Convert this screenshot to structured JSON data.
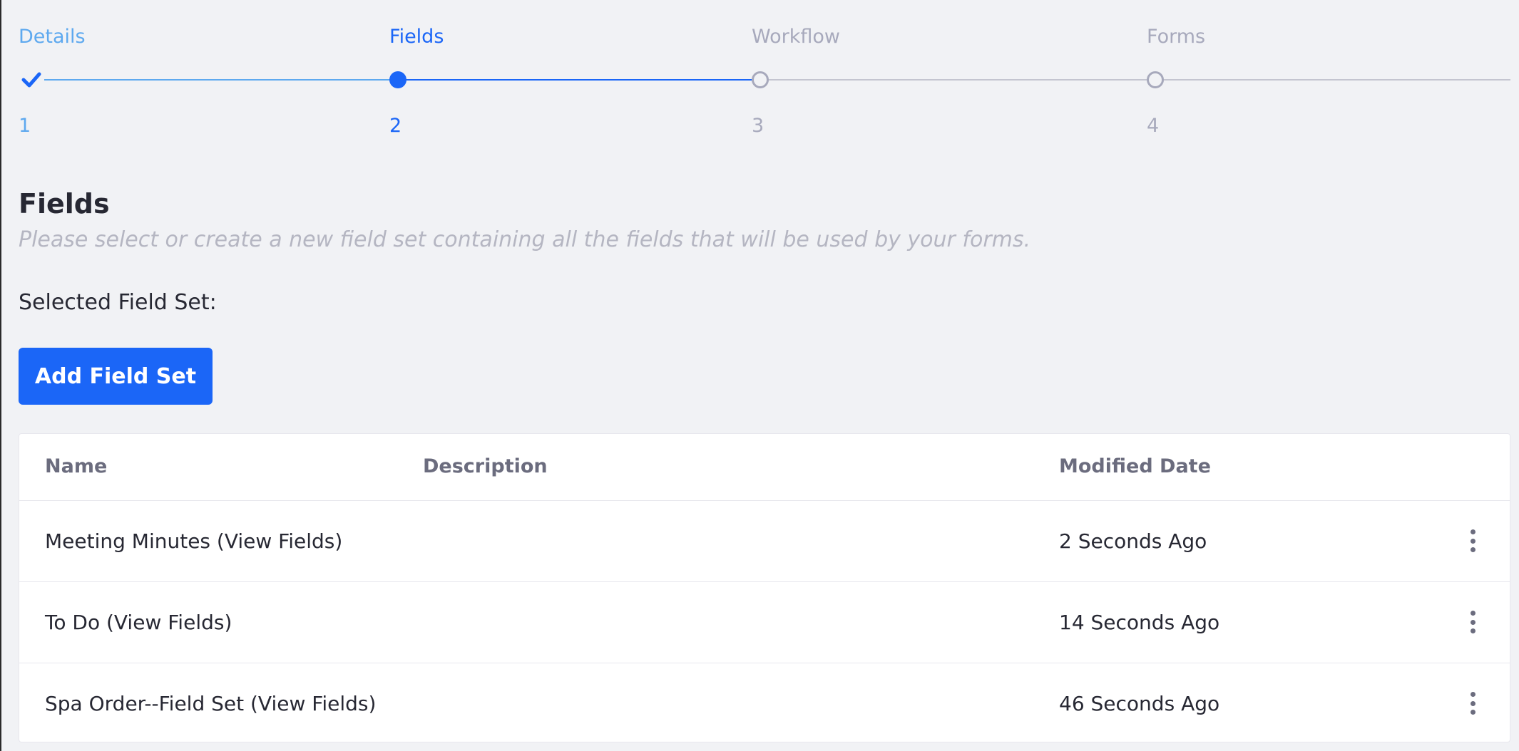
{
  "stepper": {
    "steps": [
      {
        "title": "Details",
        "number": "1",
        "state": "complete"
      },
      {
        "title": "Fields",
        "number": "2",
        "state": "active"
      },
      {
        "title": "Workflow",
        "number": "3",
        "state": "pending"
      },
      {
        "title": "Forms",
        "number": "4",
        "state": "pending"
      }
    ],
    "colors": {
      "complete": "#5ea9ef",
      "active": "#1b66f7",
      "pending": "#a7a9bc"
    }
  },
  "section": {
    "title": "Fields",
    "description": "Please select or create a new field set containing all the fields that will be used by your forms.",
    "selected_label": "Selected Field Set:",
    "add_button_label": "Add Field Set"
  },
  "table": {
    "columns": {
      "name": "Name",
      "description": "Description",
      "modified": "Modified Date"
    },
    "rows": [
      {
        "name": "Meeting Minutes (View Fields)",
        "description": "",
        "modified": "2 Seconds Ago",
        "actions_icon": "kebab-icon"
      },
      {
        "name": "To Do (View Fields)",
        "description": "",
        "modified": "14 Seconds Ago",
        "actions_icon": "kebab-icon"
      },
      {
        "name": "Spa Order--Field Set (View Fields)",
        "description": "",
        "modified": "46 Seconds Ago",
        "actions_icon": "kebab-icon"
      }
    ]
  },
  "theme": {
    "background": "#f1f2f5",
    "primary": "#1b66f7",
    "muted_text": "#b5b6c2",
    "header_text": "#6b6c7e"
  }
}
